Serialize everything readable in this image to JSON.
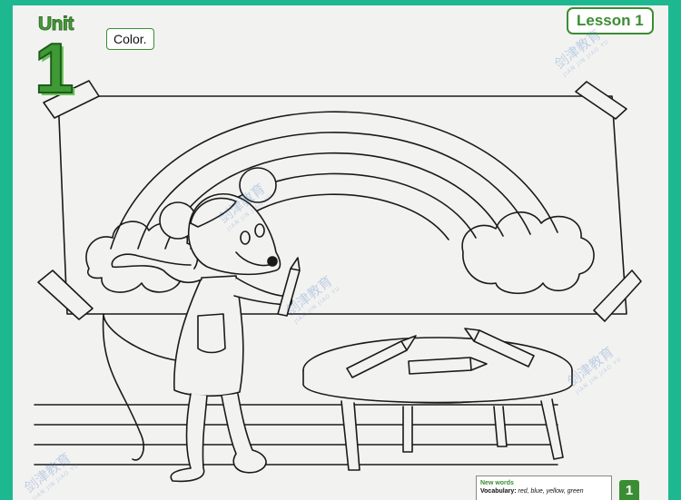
{
  "header": {
    "unit_label": "Unit",
    "unit_number": "1",
    "instruction": "Color.",
    "lesson": "Lesson 1"
  },
  "new_words": {
    "title": "New words",
    "vocabulary_label": "Vocabulary:",
    "vocabulary": "red, blue, yellow, green"
  },
  "page_number": "1",
  "watermark": {
    "text": "剑津教育",
    "subtext": "JIAN JIN JIAO YU"
  },
  "colors": {
    "background": "#1db890",
    "accent_green": "#3b8d33",
    "watermark": "#3c78be"
  }
}
